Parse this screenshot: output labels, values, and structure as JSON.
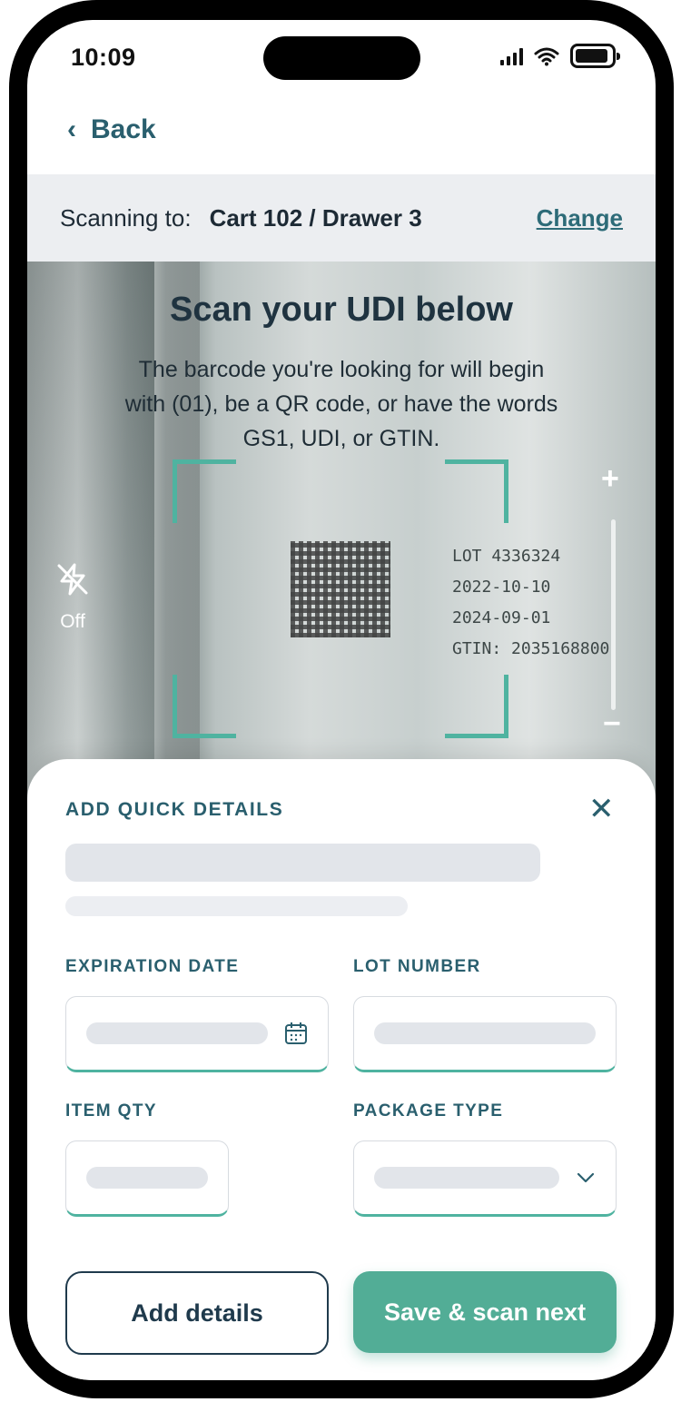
{
  "status_bar": {
    "time": "10:09"
  },
  "header": {
    "back_label": "Back"
  },
  "scan_target": {
    "prefix": "Scanning to:",
    "location": "Cart 102 / Drawer 3",
    "change_label": "Change"
  },
  "camera": {
    "title": "Scan your UDI below",
    "description": "The barcode you're looking for will begin with (01), be a QR code, or have the words GS1, UDI, or GTIN.",
    "flash_label": "Off",
    "zoom_in": "+",
    "zoom_out": "−",
    "package_text": {
      "lot": "LOT 4336324",
      "manufactured": "2022-10-10",
      "expiry": "2024-09-01",
      "gtin": "GTIN: 2035168800"
    }
  },
  "sheet": {
    "title": "ADD QUICK DETAILS",
    "fields": {
      "expiration": {
        "label": "EXPIRATION DATE"
      },
      "lot": {
        "label": "LOT NUMBER"
      },
      "qty": {
        "label": "ITEM QTY"
      },
      "package": {
        "label": "PACKAGE TYPE"
      }
    },
    "add_details_label": "Add details",
    "save_label": "Save & scan next"
  },
  "colors": {
    "accent": "#52ad96",
    "heading": "#2a5f6e",
    "dark": "#1f3a4c"
  }
}
